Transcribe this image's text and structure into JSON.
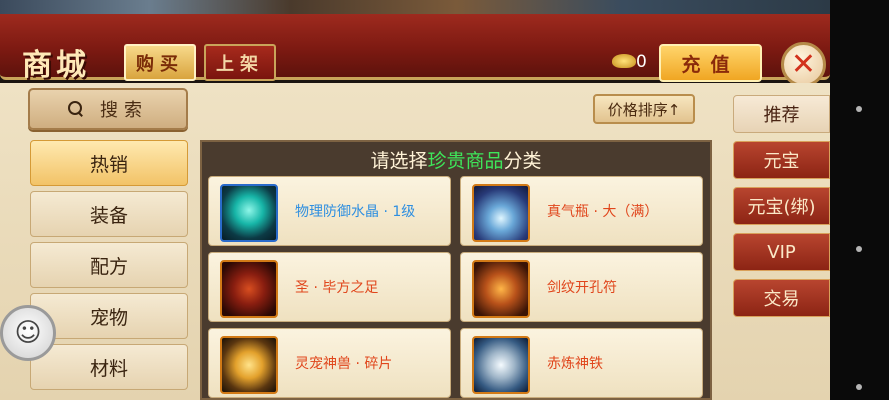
{
  "header": {
    "title": "商城",
    "buy_label": "购买",
    "sell_label": "上架",
    "gold_count": "0",
    "charge_label": "充值",
    "close_symbol": "✕"
  },
  "search": {
    "label": "搜索"
  },
  "categories": [
    {
      "label": "热销",
      "active": true
    },
    {
      "label": "装备"
    },
    {
      "label": "配方"
    },
    {
      "label": "宠物"
    },
    {
      "label": "材料"
    }
  ],
  "sort": {
    "label": "价格排序↑"
  },
  "grid": {
    "title_prefix": "请选择",
    "title_highlight": "珍贵商品",
    "title_suffix": "分类",
    "items": [
      {
        "name": "物理防御水晶 · 1级",
        "color": "#2f8fe0",
        "icon": "crystal-icon"
      },
      {
        "name": "真气瓶 · 大（满）",
        "color": "#e0461c",
        "icon": "bottle-icon"
      },
      {
        "name": "圣 · 毕方之足",
        "color": "#e0461c",
        "icon": "claw-icon"
      },
      {
        "name": "剑纹开孔符",
        "color": "#e0461c",
        "icon": "scroll-icon"
      },
      {
        "name": "灵宠神兽 · 碎片",
        "color": "#e0461c",
        "icon": "egg-icon"
      },
      {
        "name": "赤炼神铁",
        "color": "#e0461c",
        "icon": "iron-icon"
      }
    ]
  },
  "tabs": [
    {
      "label": "推荐"
    },
    {
      "label": "元宝"
    },
    {
      "label": "元宝(绑)"
    },
    {
      "label": "VIP"
    },
    {
      "label": "交易"
    }
  ],
  "colors": {
    "accent_red": "#9e2a1e",
    "highlight_green": "#3ee55a",
    "gold": "#f0a623"
  },
  "float_ball": {
    "symbol": "☺"
  }
}
